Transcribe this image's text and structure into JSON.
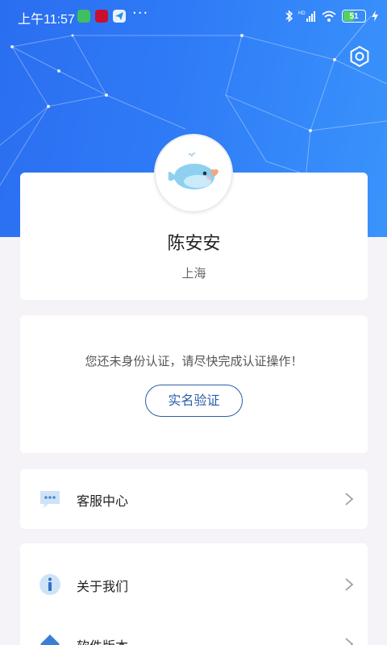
{
  "status_bar": {
    "time": "上午11:57",
    "dots": "···",
    "hd_label": "HD",
    "battery_level": "51",
    "battery_color": "#52d35a"
  },
  "profile": {
    "name": "陈安安",
    "city": "上海",
    "avatar_icon": "whale-icon"
  },
  "verify": {
    "message": "您还未身份认证，请尽快完成认证操作！",
    "button_label": "实名验证"
  },
  "menu": {
    "service": {
      "label": "客服中心",
      "icon": "chat-bubble-icon"
    },
    "about": {
      "label": "关于我们",
      "icon": "info-icon"
    },
    "version": {
      "label": "软件版本",
      "icon": "diamond-icon"
    }
  },
  "colors": {
    "header_blue": "#2f7bf7",
    "accent": "#2a5ea8",
    "background": "#f5f3f7"
  }
}
